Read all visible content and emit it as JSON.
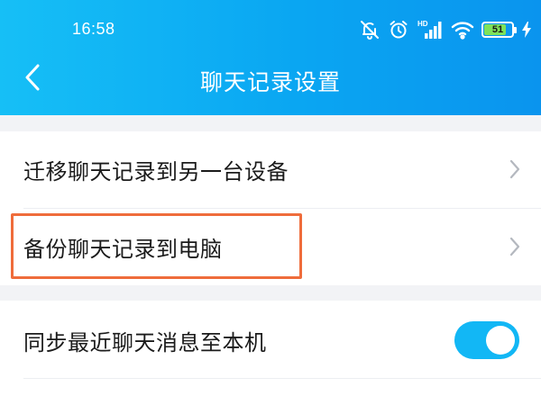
{
  "status_bar": {
    "time": "16:58",
    "icons": [
      "bell-off-icon",
      "alarm-icon",
      "hd-signal-icon",
      "wifi-icon",
      "battery-icon",
      "charging-icon"
    ],
    "battery_level": "51",
    "network_label": "HD"
  },
  "nav": {
    "back_icon": "chevron-left-icon",
    "title": "聊天记录设置"
  },
  "settings": {
    "items": [
      {
        "label": "迁移聊天记录到另一台设备",
        "action": "chevron-right-icon"
      },
      {
        "label": "备份聊天记录到电脑",
        "action": "chevron-right-icon",
        "highlighted": true
      },
      {
        "label": "同步最近聊天消息至本机",
        "toggle_on": true
      }
    ]
  },
  "colors": {
    "header_start": "#16bff6",
    "header_end": "#0a94ee",
    "highlight_border": "#ef6c3b",
    "toggle_on": "#12b7f5",
    "battery_fill": "#7fe25a"
  }
}
